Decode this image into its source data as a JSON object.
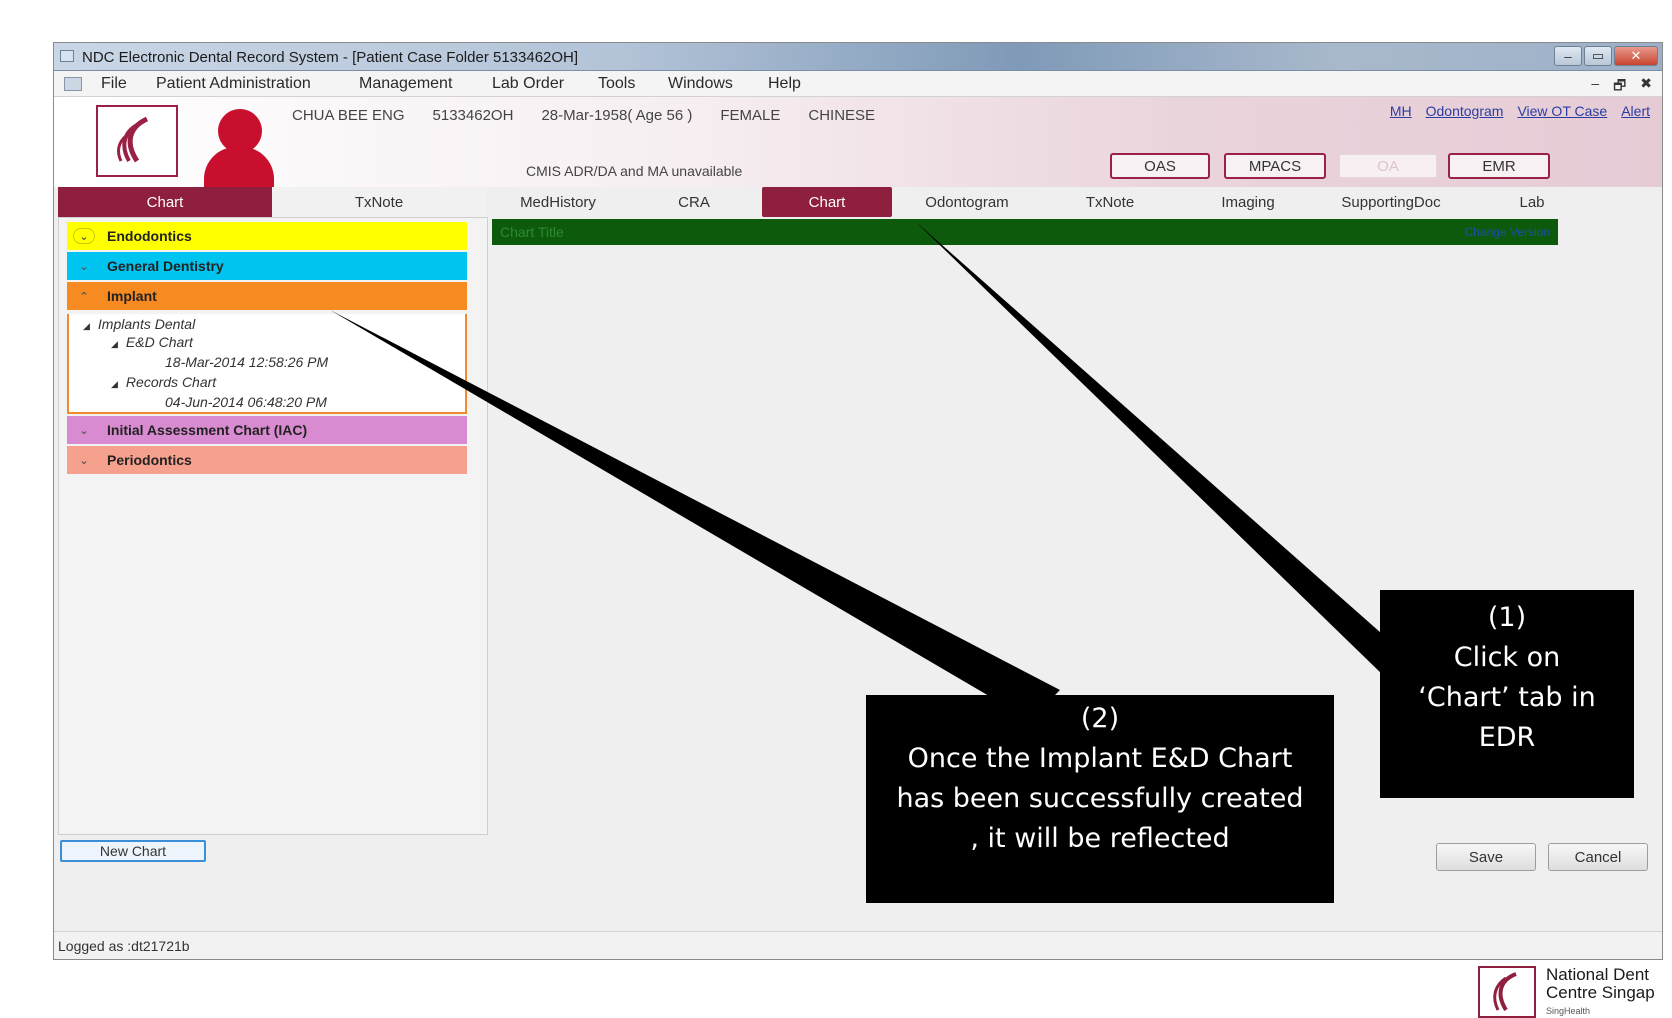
{
  "window": {
    "title": "NDC Electronic Dental Record System - [Patient Case Folder 5133462OH]",
    "controls": {
      "minimize": "–",
      "restore": "▭",
      "close": "✕"
    }
  },
  "menu": {
    "items": [
      "File",
      "Patient Administration",
      "Management",
      "Lab Order",
      "Tools",
      "Windows",
      "Help"
    ],
    "mdi_controls": [
      "–",
      "🗗",
      "✖"
    ]
  },
  "patient": {
    "name": "CHUA BEE ENG",
    "id": "5133462OH",
    "dob_age": "28-Mar-1958( Age 56 )",
    "sex": "FEMALE",
    "race": "CHINESE",
    "cmis_notice": "CMIS ADR/DA and MA unavailable"
  },
  "header_links": [
    "MH",
    "Odontogram",
    "View OT Case",
    "Alert"
  ],
  "header_buttons": {
    "oas": "OAS",
    "mpacs": "MPACS",
    "disabled": "OA",
    "emr": "EMR"
  },
  "left_tabs": [
    "Chart",
    "TxNote"
  ],
  "main_tabs": [
    "MedHistory",
    "CRA",
    "Chart",
    "Odontogram",
    "TxNote",
    "Imaging",
    "SupportingDoc",
    "Lab"
  ],
  "chart_groups": {
    "endodontics": "Endodontics",
    "general": "General Dentistry",
    "implant": "Implant",
    "iac": "Initial Assessment Chart (IAC)",
    "perio": "Periodontics"
  },
  "implant_tree": {
    "root": "Implants Dental",
    "chart1": "E&D Chart",
    "chart1_date": "18-Mar-2014 12:58:26 PM",
    "chart2": "Records Chart",
    "chart2_date": "04-Jun-2014 06:48:20 PM"
  },
  "content": {
    "chart_title": "Chart Title",
    "chart_link": "Change Version"
  },
  "buttons": {
    "new_chart": "New Chart",
    "save": "Save",
    "cancel": "Cancel"
  },
  "status": "Logged as :dt21721b",
  "callouts": {
    "one": [
      "(1)",
      "Click on",
      "‘Chart’ tab in",
      "EDR"
    ],
    "two": [
      "(2)",
      "Once the  Implant  E&D Chart",
      "has been successfully created",
      ", it will be reflected"
    ]
  },
  "ndc_logo": {
    "line1": "National Dent",
    "line2": "Centre Singap",
    "line3": "SingHealth"
  },
  "colors": {
    "brand": "#8e1f3f",
    "endodontics": "#ffff00",
    "general_dentistry": "#00c4f0",
    "implant": "#f88a22",
    "iac": "#d88bd0",
    "periodontics": "#f6a08e",
    "chart_title_bar": "#0d5a0d"
  }
}
